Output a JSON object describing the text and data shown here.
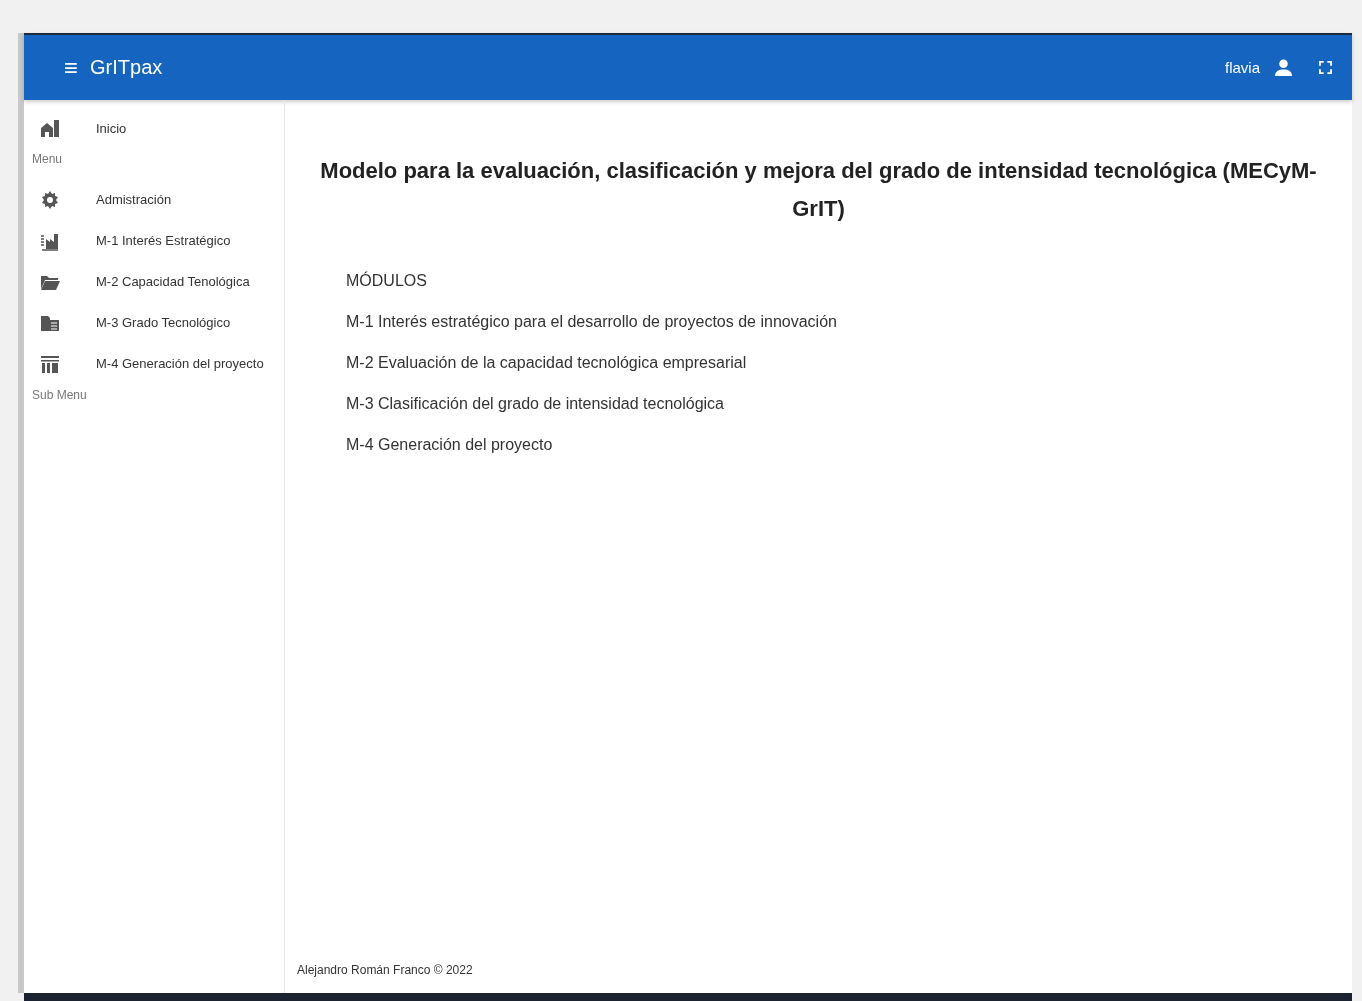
{
  "app_bar": {
    "menu_glyph": "≡",
    "title": "GrITpax",
    "user": "flavia"
  },
  "sidebar": {
    "items": [
      {
        "kind": "link",
        "label": "Inicio"
      },
      {
        "kind": "header",
        "label": "Menu"
      },
      {
        "kind": "link",
        "label": "Admistración"
      },
      {
        "kind": "link",
        "label": "M-1 Interés Estratégico"
      },
      {
        "kind": "link",
        "label": "M-2 Capacidad Tenológica"
      },
      {
        "kind": "link",
        "label": "M-3 Grado Tecnológico"
      },
      {
        "kind": "link",
        "label": "M-4 Generación del proyecto"
      },
      {
        "kind": "header",
        "label": "Sub Menu"
      }
    ]
  },
  "main": {
    "title": "Modelo para la evaluación, clasificación y mejora del grado de intensidad tecnológica (MECyM-GrIT)",
    "modules_heading": "MÓDULOS",
    "modules": [
      "M-1 Interés estratégico para el desarrollo de proyectos de innovación",
      "M-2 Evaluación de la capacidad tecnológica empresarial",
      "M-3 Clasificación del grado de intensidad tecnológica",
      "M-4 Generación del proyecto"
    ]
  },
  "footer": "Alejandro Román Franco © 2022"
}
